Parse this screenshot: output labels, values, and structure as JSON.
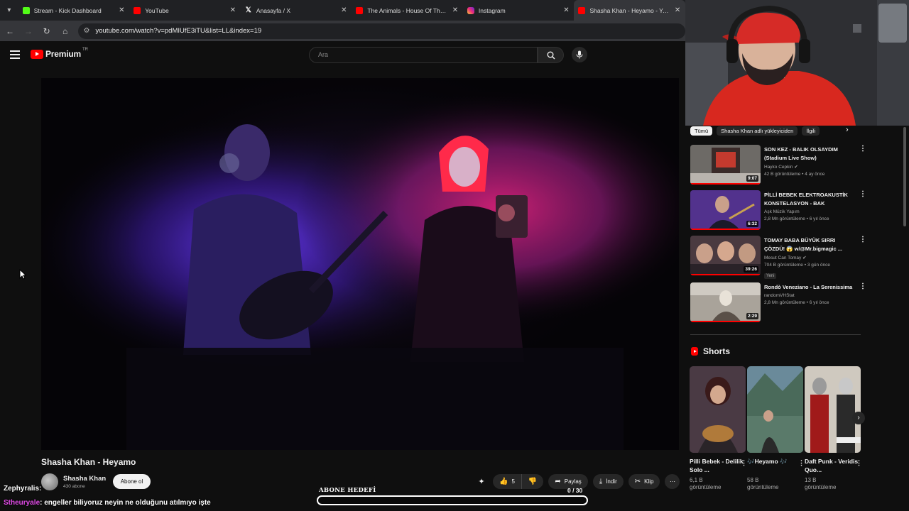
{
  "browser": {
    "tabs": [
      {
        "title": "Stream - Kick Dashboard",
        "icon": "kick-icon"
      },
      {
        "title": "YouTube",
        "icon": "youtube-icon"
      },
      {
        "title": "Anasayfa / X",
        "icon": "x-icon"
      },
      {
        "title": "The Animals - House Of The Rising Sun",
        "icon": "youtube-icon"
      },
      {
        "title": "Instagram",
        "icon": "instagram-icon"
      },
      {
        "title": "Shasha Khan - Heyamo - YouTube",
        "icon": "youtube-icon",
        "active": true
      }
    ],
    "url": "youtube.com/watch?v=pdMIUfE3iTU&list=LL&index=19"
  },
  "youtube": {
    "logo_text": "Premium",
    "region": "TR",
    "search_placeholder": "Ara"
  },
  "video": {
    "title": "Shasha Khan - Heyamo",
    "channel_name": "Shasha Khan",
    "channel_subs": "430 abone",
    "subscribe_label": "Abone ol",
    "likes": "5",
    "share_label": "Paylaş",
    "download_label": "İndir",
    "clip_label": "Klip"
  },
  "sidebar": {
    "chips": [
      "Tümü",
      "Shasha Khan adlı yükleyiciden",
      "İlgili"
    ],
    "recommendations": [
      {
        "title": "SON KEZ - BALIK OLSAYDIM (Stadium Live Show)",
        "channel": "Hayko Cepkin",
        "verified": true,
        "meta": "42 B görüntüleme • 4 ay önce",
        "duration": "9:07",
        "badge": ""
      },
      {
        "title": "PİLLİ BEBEK ELEKTROAKUSTİK KONSTELASYON - BAK",
        "channel": "Aşk Müzik Yapım",
        "verified": false,
        "meta": "2,8 Mn görüntüleme • 6 yıl önce",
        "duration": "6:32",
        "badge": ""
      },
      {
        "title": "TOMAY BABA BÜYÜK SIRRI ÇÖZDÜ! 😱 w/@Mr.bigmagic ...",
        "channel": "Mesut Can Tomay",
        "verified": true,
        "meta": "704 B görüntüleme • 3 gün önce",
        "duration": "39:26",
        "badge": "Yeni"
      },
      {
        "title": "Rondò Veneziano - La Serenissima",
        "channel": "randomVHStat",
        "verified": false,
        "meta": "2,8 Mn görüntüleme • 6 yıl önce",
        "duration": "2:29",
        "badge": ""
      }
    ],
    "shorts_heading": "Shorts",
    "shorts": [
      {
        "title": "Pilli Bebek - Delilik Solo ...",
        "views": "6,1 B",
        "views_label": "görüntüleme"
      },
      {
        "title": "🎶Heyamo 🎶",
        "views": "58 B",
        "views_label": "görüntüleme"
      },
      {
        "title": "Daft Punk - Veridis Quo...",
        "views": "13 B",
        "views_label": "görüntüleme"
      }
    ]
  },
  "overlay": {
    "chat": [
      {
        "user": "Zephyralis",
        "message": ":"
      },
      {
        "user": "Stheuryale",
        "message": ": engeller biliyoruz neyin ne olduğunu atılmıyo işte"
      }
    ],
    "goal_label": "ABONE HEDEFİ",
    "goal_count": "0 / 30",
    "goal_current": 0,
    "goal_target": 30
  }
}
